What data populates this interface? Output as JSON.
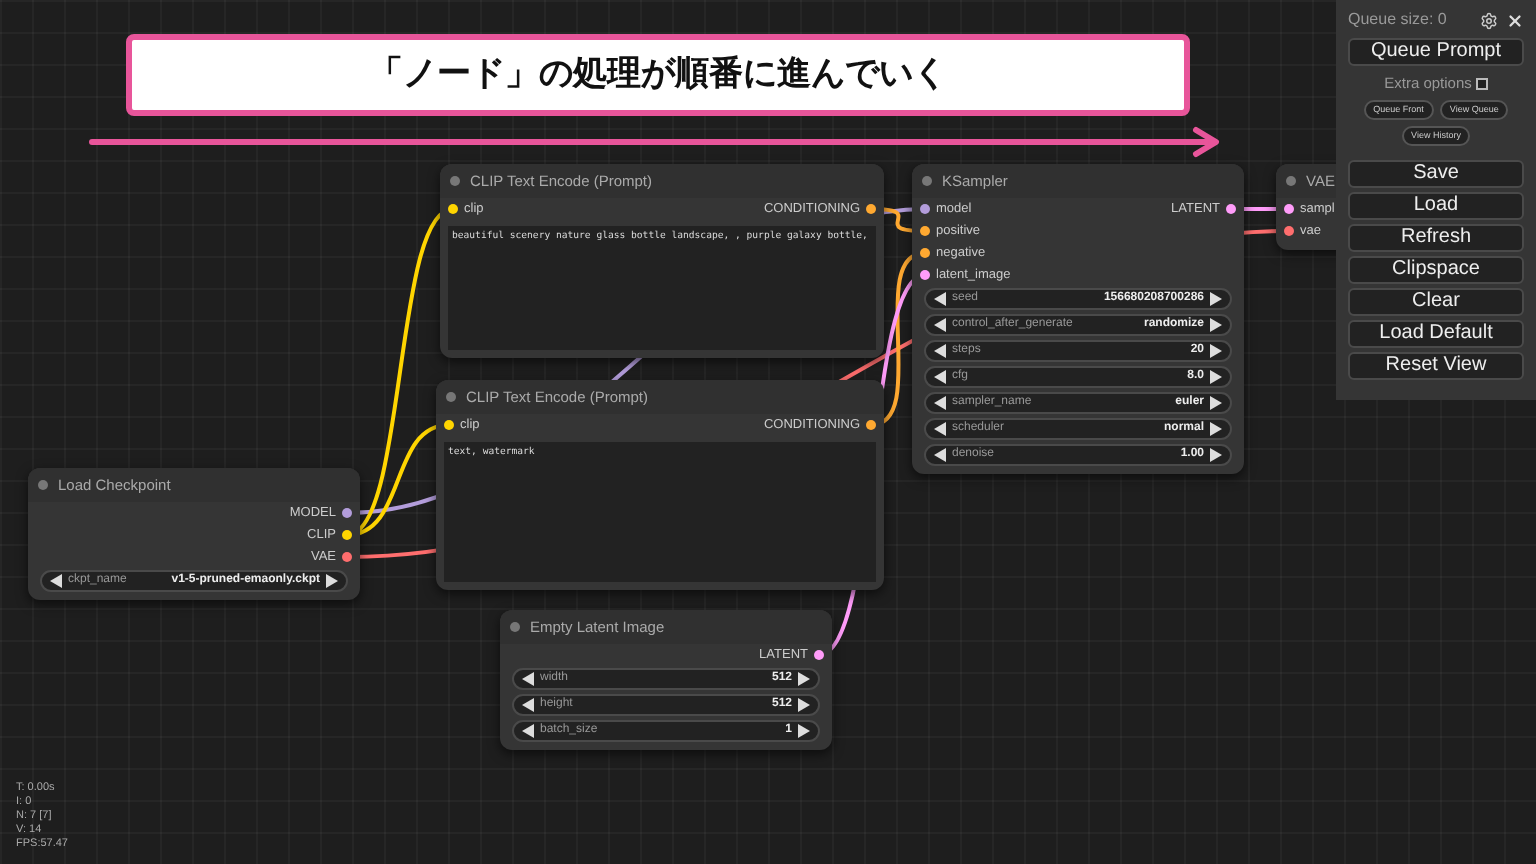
{
  "banner": {
    "text": "「ノード」の処理が順番に進んでいく"
  },
  "nodes": [
    {
      "title": "CLIP Text Encode (Prompt)",
      "inputs": [
        {
          "name": "clip",
          "color": "#ffd500"
        }
      ],
      "outputs": [
        {
          "name": "CONDITIONING",
          "color": "#ffa931"
        }
      ],
      "text": "beautiful scenery nature glass bottle landscape, , purple galaxy bottle,"
    },
    {
      "title": "KSampler",
      "inputs": [
        {
          "name": "model",
          "color": "#b39ddb"
        },
        {
          "name": "positive",
          "color": "#ffa931"
        },
        {
          "name": "negative",
          "color": "#ffa931"
        },
        {
          "name": "latent_image",
          "color": "#ff9cf9"
        }
      ],
      "outputs": [
        {
          "name": "LATENT",
          "color": "#ff9cf9"
        }
      ],
      "widgets": [
        {
          "label": "seed",
          "value": "156680208700286"
        },
        {
          "label": "control_after_generate",
          "value": "randomize"
        },
        {
          "label": "steps",
          "value": "20"
        },
        {
          "label": "cfg",
          "value": "8.0"
        },
        {
          "label": "sampler_name",
          "value": "euler"
        },
        {
          "label": "scheduler",
          "value": "normal"
        },
        {
          "label": "denoise",
          "value": "1.00"
        }
      ]
    },
    {
      "title": "VAE",
      "inputs": [
        {
          "name": "sampl",
          "color": "#ff9cf9"
        },
        {
          "name": "vae",
          "color": "#ff6e6e"
        }
      ]
    },
    {
      "title": "CLIP Text Encode (Prompt)",
      "inputs": [
        {
          "name": "clip",
          "color": "#ffd500"
        }
      ],
      "outputs": [
        {
          "name": "CONDITIONING",
          "color": "#ffa931"
        }
      ],
      "text": "text, watermark"
    },
    {
      "title": "Load Checkpoint",
      "outputs": [
        {
          "name": "MODEL",
          "color": "#b39ddb"
        },
        {
          "name": "CLIP",
          "color": "#ffd500"
        },
        {
          "name": "VAE",
          "color": "#ff6e6e"
        }
      ],
      "widgets": [
        {
          "label": "ckpt_name",
          "value": "v1-5-pruned-emaonly.ckpt"
        }
      ]
    },
    {
      "title": "Empty Latent Image",
      "outputs": [
        {
          "name": "LATENT",
          "color": "#ff9cf9"
        }
      ],
      "widgets": [
        {
          "label": "width",
          "value": "512"
        },
        {
          "label": "height",
          "value": "512"
        },
        {
          "label": "batch_size",
          "value": "1"
        }
      ]
    }
  ],
  "sidebar": {
    "queue_size": "Queue size: 0",
    "queue_button": "Queue Prompt",
    "extra_options": {
      "label": "Extra options",
      "checked": false
    },
    "small_buttons": [
      "Queue Front",
      "View Queue",
      "View History"
    ],
    "buttons": [
      "Save",
      "Load",
      "Refresh",
      "Clipspace",
      "Clear",
      "Load Default",
      "Reset View"
    ]
  },
  "stats": [
    "T: 0.00s",
    "I: 0",
    "N: 7 [7]",
    "V: 14",
    "FPS:57.47"
  ]
}
